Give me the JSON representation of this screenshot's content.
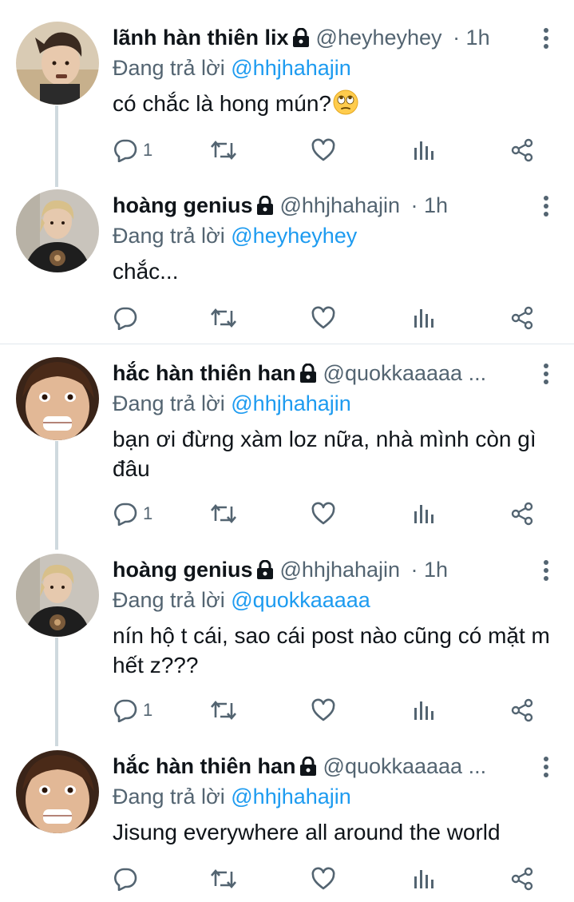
{
  "tweets": [
    {
      "name": "lãnh hàn thiên lix",
      "handle": "@heyheyhey",
      "time": "· 1h",
      "reply_prefix": "Đang trả lời ",
      "reply_to": "@hhjhahajin",
      "text": "có chắc là hong mún?",
      "emoji": "face-with-rolling-eyes",
      "reply_count": "1"
    },
    {
      "name": "hoàng genius",
      "handle": "@hhjhahajin",
      "time": "· 1h",
      "reply_prefix": "Đang trả lời ",
      "reply_to": "@heyheyhey",
      "text": "chắc...",
      "reply_count": ""
    },
    {
      "name": "hắc hàn thiên han",
      "handle": "@quokkaaaaa ...",
      "time": "",
      "reply_prefix": "Đang trả lời ",
      "reply_to": "@hhjhahajin",
      "text": "bạn ơi đừng xàm loz nữa, nhà mình còn gì đâu",
      "reply_count": "1"
    },
    {
      "name": "hoàng genius",
      "handle": "@hhjhahajin",
      "time": "· 1h",
      "reply_prefix": "Đang trả lời ",
      "reply_to": "@quokkaaaaa",
      "text": "nín hộ t cái, sao cái post nào cũng có mặt m hết z???",
      "reply_count": "1"
    },
    {
      "name": "hắc hàn thiên han",
      "handle": "@quokkaaaaa ...",
      "time": "",
      "reply_prefix": "Đang trả lời ",
      "reply_to": "@hhjhahajin",
      "text": "Jisung everywhere all around the world",
      "reply_count": ""
    }
  ],
  "icons": {
    "lock": "lock-icon",
    "more": "more-vertical-icon",
    "reply": "reply-icon",
    "retweet": "retweet-icon",
    "like": "heart-icon",
    "analytics": "analytics-icon",
    "share": "share-icon"
  },
  "colors": {
    "text": "#0f1419",
    "secondary": "#536471",
    "mention": "#1d9bf0",
    "thread_line": "#cfd9de"
  }
}
